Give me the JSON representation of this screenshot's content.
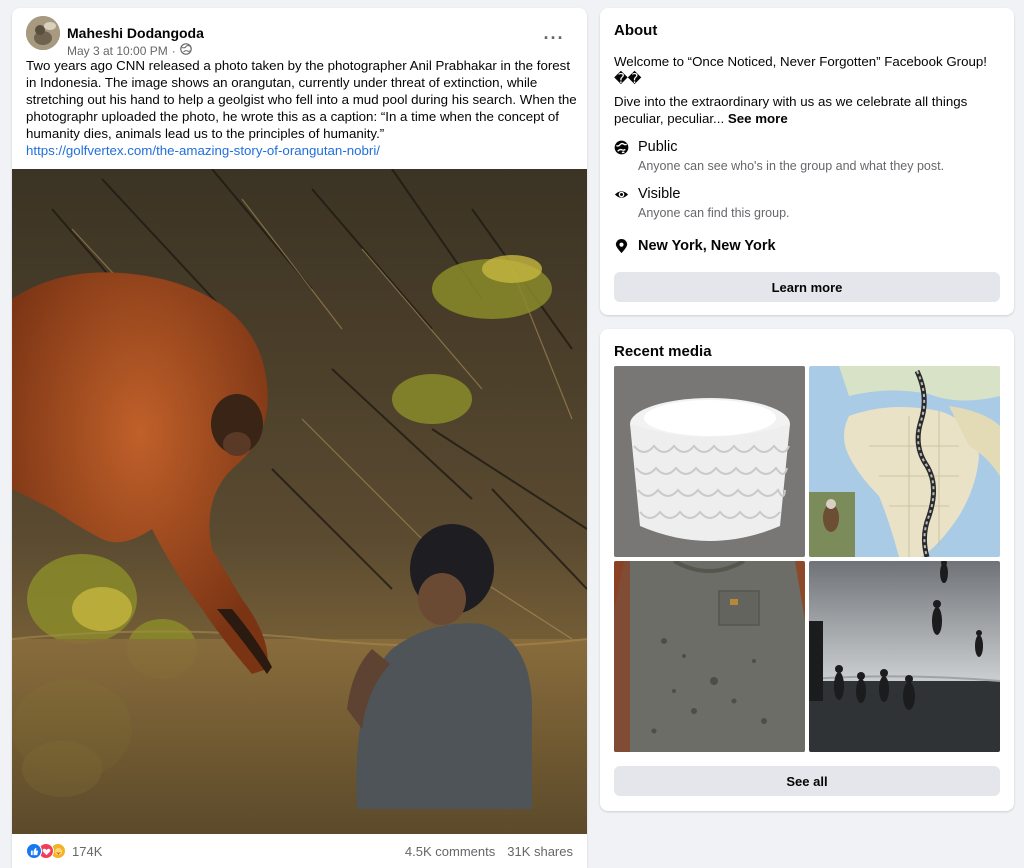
{
  "post": {
    "author": "Maheshi Dodangoda",
    "timestamp": "May 3 at 10:00 PM",
    "separator": "·",
    "privacy_icon": "globe-icon",
    "more_label": "···",
    "body": "Two years ago CNN released a photo taken by the photographer Anil Prabhakar in the forest in Indonesia. The image shows an orangutan, currently under threat of extinction, while stretching out his hand to help a geolgist who fell into a mud pool during his search. When the photographr uploaded the photo, he wrote this as a caption: “In a time when the concept of humanity dies, animals lead us to the principles of humanity.”",
    "link": "https://golfvertex.com/the-amazing-story-of-orangutan-nobri/",
    "reaction_icons": [
      "like-icon",
      "love-icon",
      "care-icon"
    ],
    "reaction_count": "174K",
    "comments": "4.5K comments",
    "shares": "31K shares"
  },
  "about": {
    "title": "About",
    "welcome": "Welcome to “Once Noticed, Never Forgotten” Facebook Group! ��",
    "description": "Dive into the extraordinary with us as we celebrate all things peculiar, peculiar...",
    "see_more": "See more",
    "public_title": "Public",
    "public_sub": "Anyone can see who's in the group and what they post.",
    "visible_title": "Visible",
    "visible_sub": "Anyone can find this group.",
    "location": "New York, New York",
    "learn_more": "Learn more"
  },
  "recent_media": {
    "title": "Recent media",
    "see_all": "See all"
  },
  "colors": {
    "link": "#216fdb",
    "background": "#f0f2f5",
    "button_gray": "#e4e6eb",
    "secondary_text": "#65676b",
    "like_blue": "#1877f2",
    "love_red": "#f33e58"
  }
}
